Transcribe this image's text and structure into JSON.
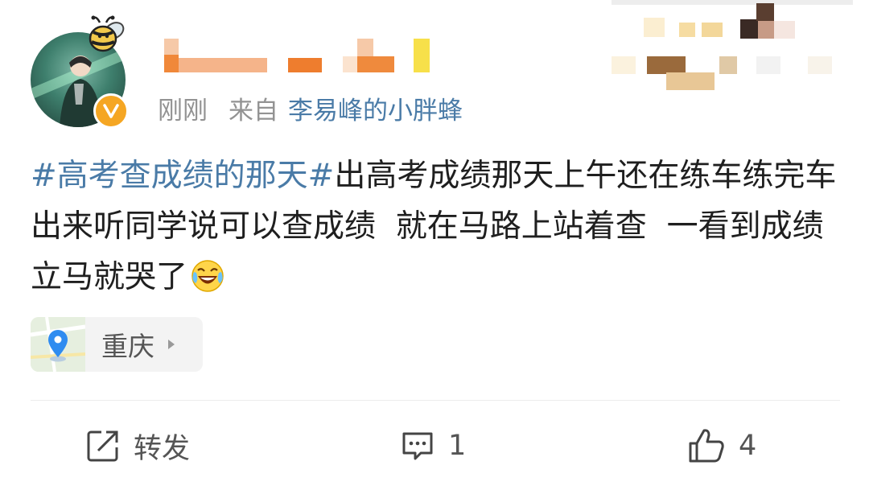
{
  "post": {
    "timestamp": "刚刚",
    "source_prefix": "来自",
    "source_name": "李易峰的小胖蜂",
    "content": {
      "topic": "#高考查成绩的那天#",
      "text": "出高考成绩那天上午还在练车练完车出来听同学说可以查成绩  就在马路上站着查  一看到成绩立马就哭了",
      "emoji": "laughing-crying-emoji"
    },
    "location": "重庆",
    "actions": {
      "repost_label": "转发",
      "comment_count": "1",
      "like_count": "4"
    },
    "colors": {
      "link_blue": "#4a7ba7",
      "verified_badge": "#f5a623",
      "meta_gray": "#939393"
    }
  }
}
